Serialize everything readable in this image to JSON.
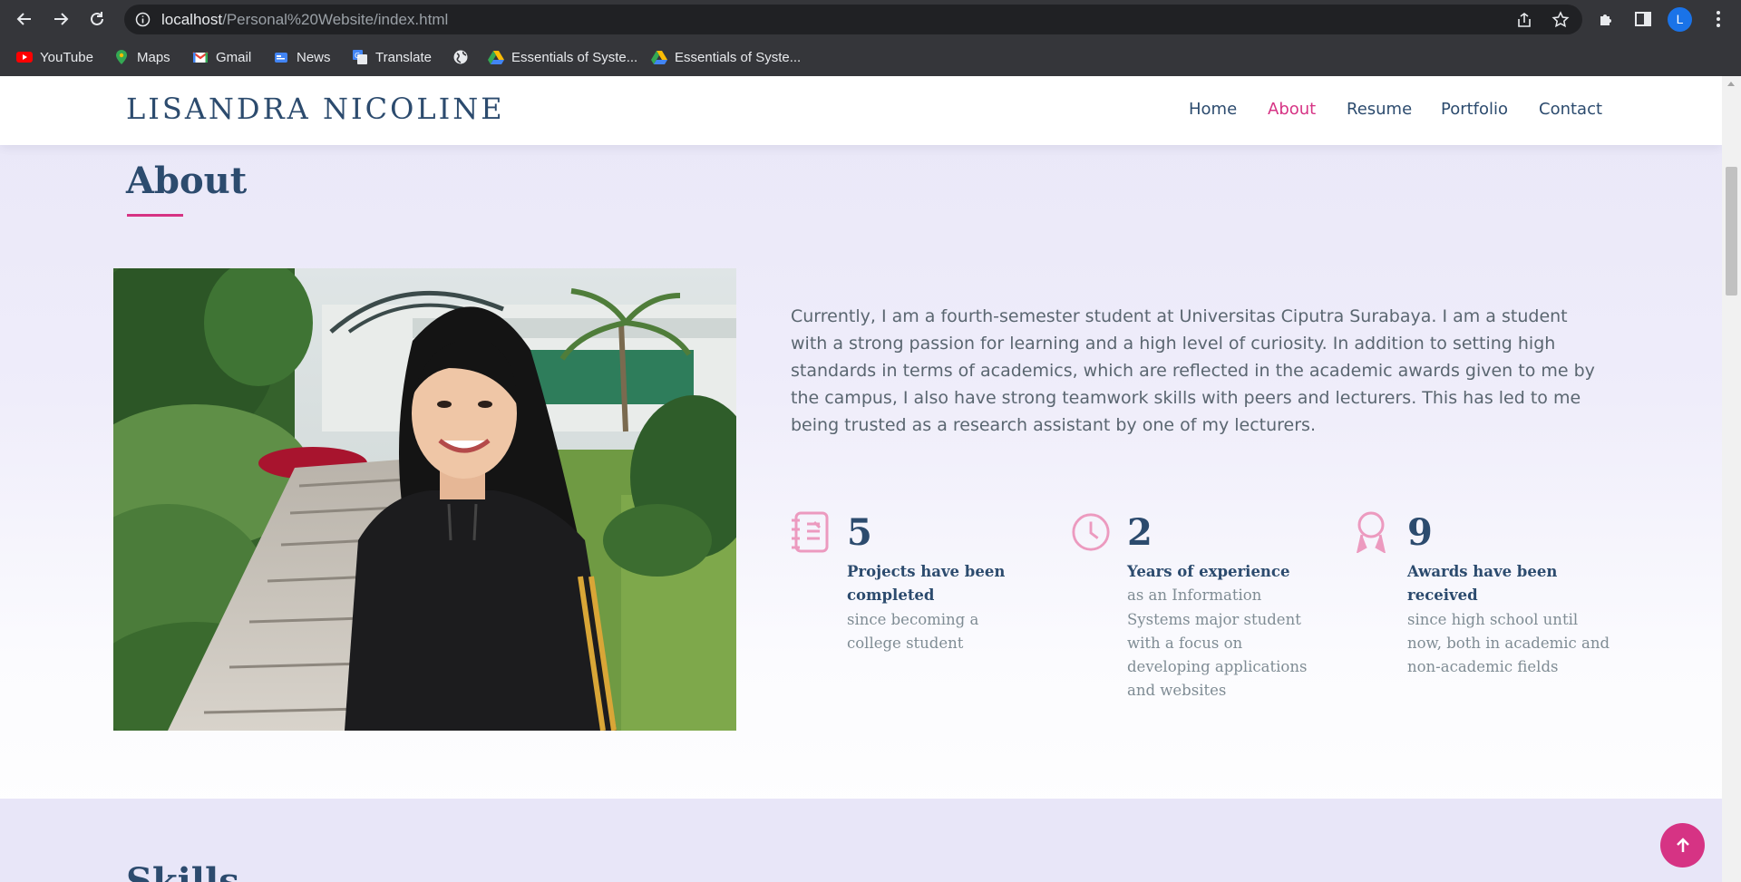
{
  "browser": {
    "url_host": "localhost",
    "url_path": "/Personal%20Website/index.html",
    "profile_initial": "L",
    "bookmarks": [
      {
        "label": "YouTube",
        "icon": "youtube-icon"
      },
      {
        "label": "Maps",
        "icon": "maps-icon"
      },
      {
        "label": "Gmail",
        "icon": "gmail-icon"
      },
      {
        "label": "News",
        "icon": "news-icon"
      },
      {
        "label": "Translate",
        "icon": "translate-icon"
      },
      {
        "label": "",
        "icon": "globe-icon"
      },
      {
        "label": "Essentials of Syste...",
        "icon": "google-drive-icon"
      },
      {
        "label": "Essentials of Syste...",
        "icon": "google-drive-icon"
      }
    ]
  },
  "site": {
    "logo": "LISANDRA NICOLINE",
    "nav": [
      {
        "label": "Home",
        "active": false
      },
      {
        "label": "About",
        "active": true
      },
      {
        "label": "Resume",
        "active": false
      },
      {
        "label": "Portfolio",
        "active": false
      },
      {
        "label": "Contact",
        "active": false
      }
    ],
    "accent_color": "#d63384",
    "heading_color": "#2c4b6e"
  },
  "about": {
    "title": "About",
    "photo_alt": "Portrait of a smiling student standing by garden stairs",
    "text": "Currently, I am a fourth-semester student at Universitas Ciputra Surabaya. I am a student with a strong passion for learning and a high level of curiosity. In addition to setting high standards in terms of academics, which are reflected in the academic awards given to me by the campus, I also have strong teamwork skills with peers and lecturers. This has led to me being trusted as a research assistant by one of my lecturers.",
    "stats": [
      {
        "icon": "journal-icon",
        "value": "5",
        "heading": "Projects have been completed",
        "detail": "since becoming a college student"
      },
      {
        "icon": "clock-icon",
        "value": "2",
        "heading": "Years of experience",
        "detail": "as an Information Systems major student with a focus on developing applications and websites"
      },
      {
        "icon": "award-icon",
        "value": "9",
        "heading": "Awards have been received",
        "detail": "since high school until now, both in academic and non-academic fields"
      }
    ]
  },
  "skills": {
    "title": "Skills"
  }
}
